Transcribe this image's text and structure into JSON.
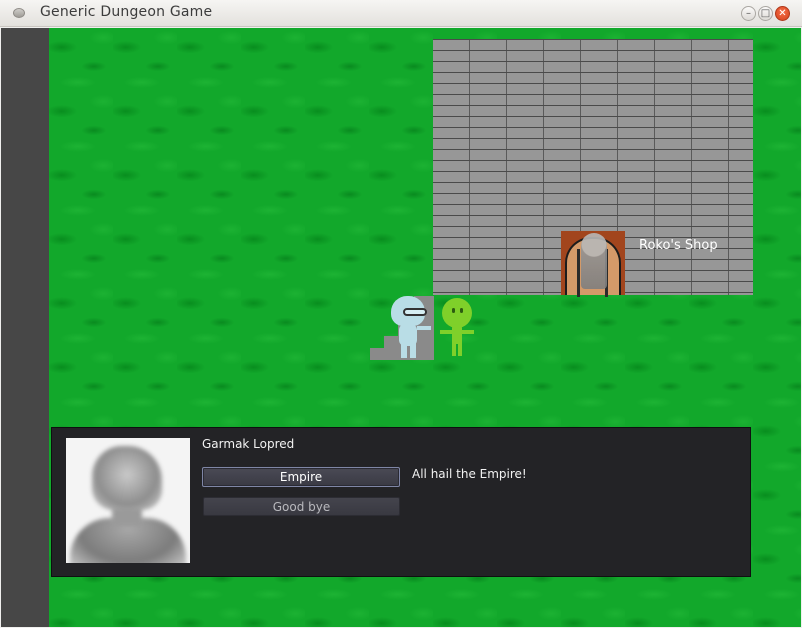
{
  "window": {
    "title": "Generic Dungeon Game",
    "minimize_glyph": "–",
    "maximize_glyph": "□",
    "close_glyph": "✕"
  },
  "map": {
    "shop_label": "Roko's Shop"
  },
  "dialog": {
    "npc_name": "Garmak Lopred",
    "options": [
      "Empire",
      "Good bye"
    ],
    "reply": "All hail the Empire!"
  },
  "colors": {
    "grass": "#12a82b",
    "wall": "#979797",
    "dialog_bg": "#232326",
    "left_strip": "#474747"
  }
}
